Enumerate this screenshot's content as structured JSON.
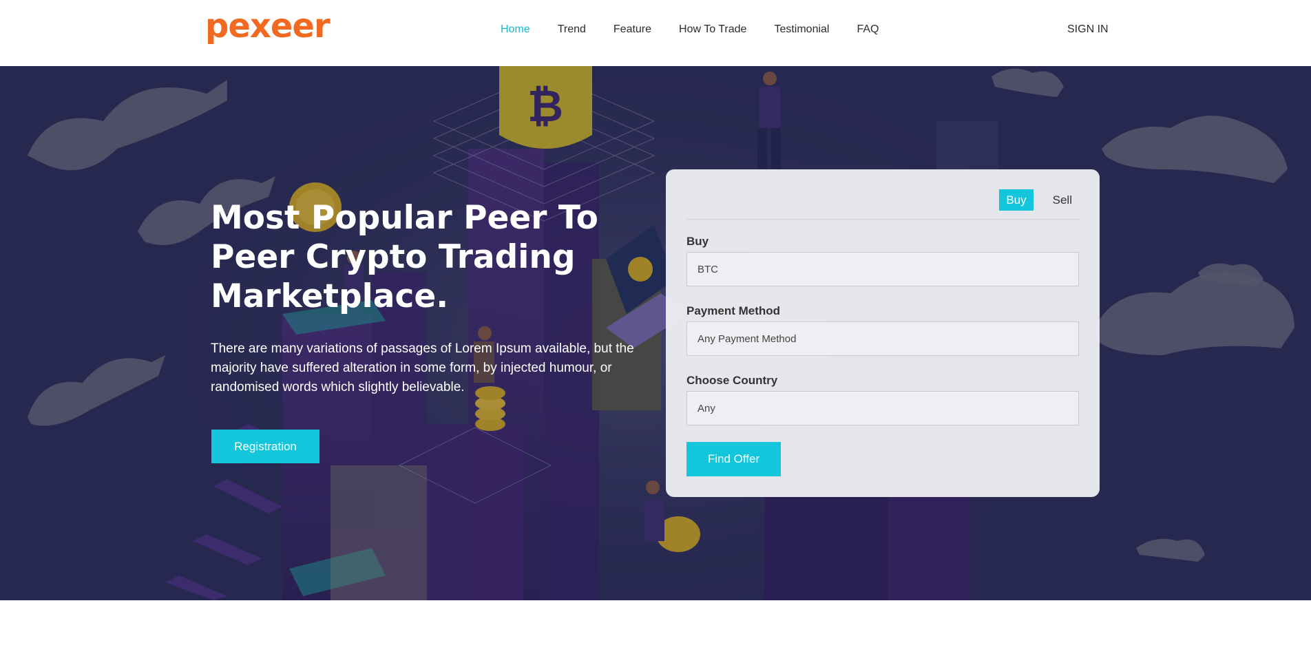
{
  "header": {
    "logo_text": "pexeer",
    "nav": [
      {
        "label": "Home",
        "active": true
      },
      {
        "label": "Trend",
        "active": false
      },
      {
        "label": "Feature",
        "active": false
      },
      {
        "label": "How To Trade",
        "active": false
      },
      {
        "label": "Testimonial",
        "active": false
      },
      {
        "label": "FAQ",
        "active": false
      }
    ],
    "signin_label": "SIGN IN"
  },
  "hero": {
    "title": "Most Popular Peer To Peer Crypto Trading Marketplace.",
    "description": "There are many variations of passages of Lorem Ipsum available, but the majority have suffered alteration in some form, by injected humour, or randomised words which slightly believable.",
    "registration_label": "Registration"
  },
  "trade_card": {
    "tabs": [
      {
        "label": "Buy",
        "active": true
      },
      {
        "label": "Sell",
        "active": false
      }
    ],
    "fields": [
      {
        "label": "Buy",
        "value": "BTC"
      },
      {
        "label": "Payment Method",
        "value": "Any Payment Method"
      },
      {
        "label": "Choose Country",
        "value": "Any"
      }
    ],
    "submit_label": "Find Offer"
  },
  "colors": {
    "accent": "#14c6dc",
    "brand": "#f26a22",
    "hero_bg": "#272950"
  },
  "icons": [
    "bitcoin-coin-icon",
    "cloud-icon"
  ]
}
